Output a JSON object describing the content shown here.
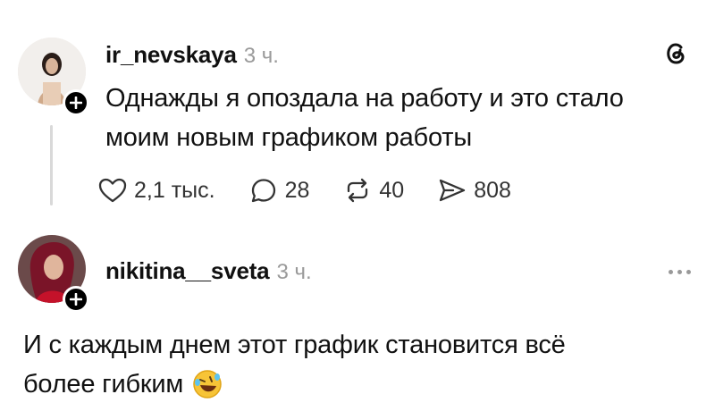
{
  "post": {
    "username": "ir_nevskaya",
    "time": "3 ч.",
    "text_line1": "Однажды я опоздала на работу и это стало",
    "text_line2": "моим новым графиком работы",
    "likes": "2,1 тыс.",
    "comments": "28",
    "reposts": "40",
    "shares": "808"
  },
  "reply": {
    "username": "nikitina__sveta",
    "time": "3 ч.",
    "text_line1": "И с каждым днем этот график становится всё",
    "text_line2": "более гибким",
    "emoji": "🤣"
  },
  "icons": {
    "logo": "threads-logo",
    "more": "more-dots-icon"
  }
}
